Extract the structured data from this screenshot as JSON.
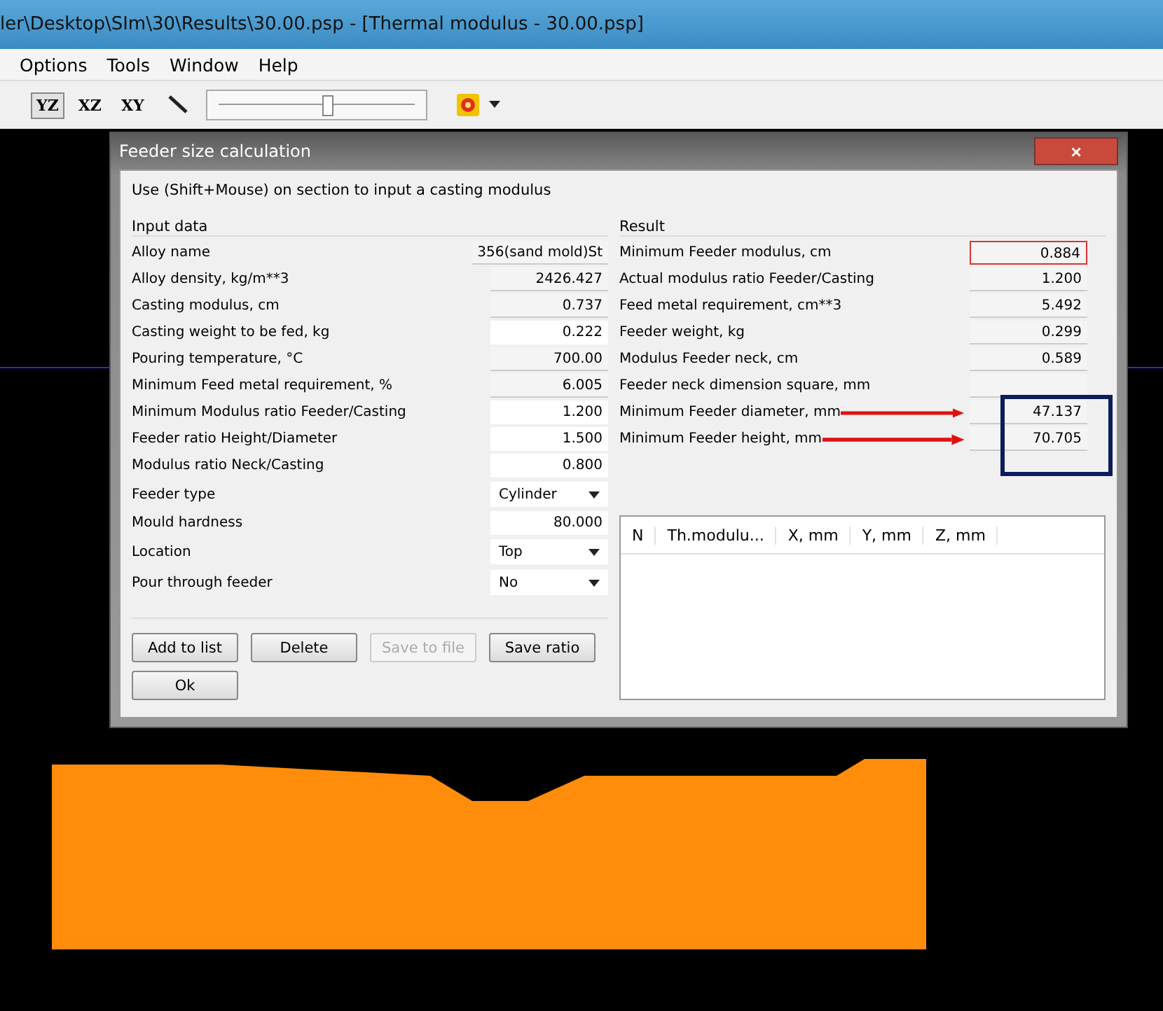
{
  "window": {
    "title": "ler\\Desktop\\SIm\\30\\Results\\30.00.psp - [Thermal modulus - 30.00.psp]"
  },
  "menu": [
    "Options",
    "Tools",
    "Window",
    "Help"
  ],
  "toolbar": {
    "views": [
      {
        "label": "YZ",
        "selected": true
      },
      {
        "label": "XZ",
        "selected": false
      },
      {
        "label": "XY",
        "selected": false
      }
    ],
    "slider": {
      "level": 0.55
    }
  },
  "dialog": {
    "title": "Feeder size calculation",
    "close": "×",
    "hint": "Use (Shift+Mouse) on section to input a casting modulus",
    "input_title": "Input data",
    "inputs": [
      {
        "label": "Alloy name",
        "value": "356(sand mold)St",
        "kind": "readonly"
      },
      {
        "label": "Alloy density, kg/m**3",
        "value": "2426.427",
        "kind": "readonly"
      },
      {
        "label": "Casting modulus, cm",
        "value": "0.737",
        "kind": "readonly"
      },
      {
        "label": "Casting weight to be fed, kg",
        "value": "0.222",
        "kind": "input"
      },
      {
        "label": "Pouring temperature, °C",
        "value": "700.00",
        "kind": "readonly"
      },
      {
        "label": "Minimum Feed metal requirement, %",
        "value": "6.005",
        "kind": "readonly"
      },
      {
        "label": "Minimum Modulus ratio Feeder/Casting",
        "value": "1.200",
        "kind": "input"
      },
      {
        "label": "Feeder ratio Height/Diameter",
        "value": "1.500",
        "kind": "input"
      },
      {
        "label": "Modulus ratio Neck/Casting",
        "value": "0.800",
        "kind": "input"
      },
      {
        "label": "Feeder type",
        "value": "Cylinder",
        "kind": "select"
      },
      {
        "label": "Mould hardness",
        "value": "80.000",
        "kind": "input"
      },
      {
        "label": "Location",
        "value": "Top",
        "kind": "select"
      },
      {
        "label": "Pour through feeder",
        "value": "No",
        "kind": "select"
      }
    ],
    "result_title": "Result",
    "results": [
      {
        "label": "Minimum Feeder modulus, cm",
        "value": "0.884",
        "highlighted": true,
        "arrow": false
      },
      {
        "label": "Actual modulus ratio Feeder/Casting",
        "value": "1.200",
        "highlighted": false,
        "arrow": false
      },
      {
        "label": "Feed metal requirement, cm**3",
        "value": "5.492",
        "highlighted": false,
        "arrow": false
      },
      {
        "label": "Feeder weight, kg",
        "value": "0.299",
        "highlighted": false,
        "arrow": false
      },
      {
        "label": "Modulus Feeder neck, cm",
        "value": "0.589",
        "highlighted": false,
        "arrow": false
      },
      {
        "label": "Feeder neck dimension square, mm",
        "highlighted": false,
        "arrow": false
      },
      {
        "label": "Minimum Feeder diameter, mm",
        "value": "47.137",
        "highlighted": false,
        "arrow": true
      },
      {
        "label": "Minimum Feeder height, mm",
        "value": "70.705",
        "highlighted": false,
        "arrow": true
      }
    ],
    "buttons": [
      {
        "label": "Add to list",
        "disabled": false
      },
      {
        "label": "Delete",
        "disabled": false
      },
      {
        "label": "Save to file",
        "disabled": true
      },
      {
        "label": "Save ratio",
        "disabled": false
      },
      {
        "label": "Ok",
        "disabled": false
      }
    ],
    "table": {
      "columns": [
        "N",
        "Th.modulu...",
        "X, mm",
        "Y, mm",
        "Z, mm"
      ]
    }
  }
}
